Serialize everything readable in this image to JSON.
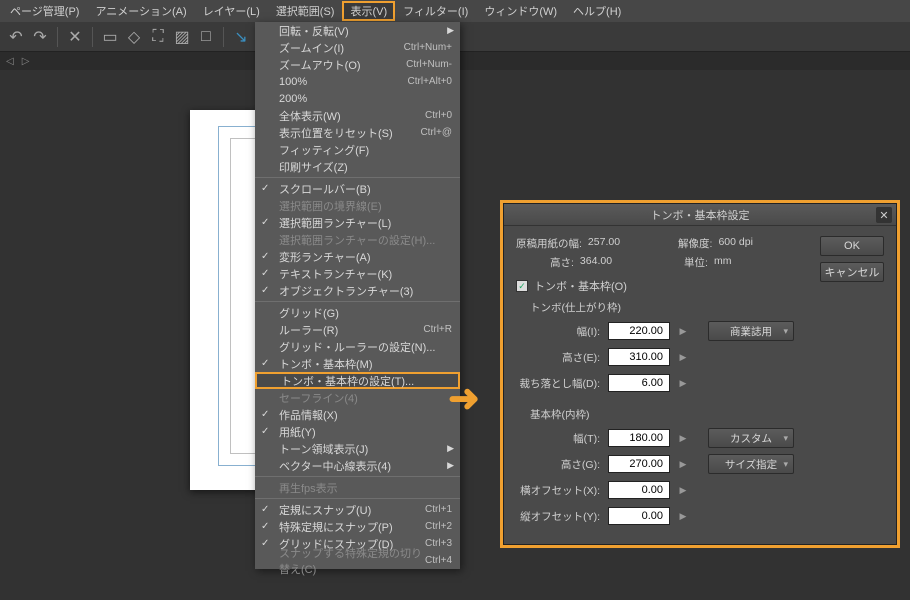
{
  "menubar": {
    "items": [
      "ページ管理(P)",
      "アニメーション(A)",
      "レイヤー(L)",
      "選択範囲(S)",
      "表示(V)",
      "フィルター(I)",
      "ウィンドウ(W)",
      "ヘルプ(H)"
    ],
    "highlighted_index": 4
  },
  "dropdown": {
    "title": "表示(V)",
    "groups": [
      [
        {
          "label": "回転・反転(V)",
          "arrow": true
        },
        {
          "label": "ズームイン(I)",
          "shortcut": "Ctrl+Num+"
        },
        {
          "label": "ズームアウト(O)",
          "shortcut": "Ctrl+Num-"
        },
        {
          "label": "100%",
          "shortcut": "Ctrl+Alt+0"
        },
        {
          "label": "200%"
        },
        {
          "label": "全体表示(W)",
          "shortcut": "Ctrl+0"
        },
        {
          "label": "表示位置をリセット(S)",
          "shortcut": "Ctrl+@"
        },
        {
          "label": "フィッティング(F)"
        },
        {
          "label": "印刷サイズ(Z)"
        }
      ],
      [
        {
          "label": "スクロールバー(B)",
          "checked": true
        },
        {
          "label": "選択範囲の境界線(E)",
          "disabled": true
        },
        {
          "label": "選択範囲ランチャー(L)",
          "checked": true
        },
        {
          "label": "選択範囲ランチャーの設定(H)...",
          "disabled": true
        },
        {
          "label": "変形ランチャー(A)",
          "checked": true
        },
        {
          "label": "テキストランチャー(K)",
          "checked": true
        },
        {
          "label": "オブジェクトランチャー(3)",
          "checked": true
        }
      ],
      [
        {
          "label": "グリッド(G)"
        },
        {
          "label": "ルーラー(R)",
          "shortcut": "Ctrl+R"
        },
        {
          "label": "グリッド・ルーラーの設定(N)..."
        },
        {
          "label": "トンボ・基本枠(M)",
          "checked": true
        },
        {
          "label": "トンボ・基本枠の設定(T)...",
          "highlight": true
        },
        {
          "label": "セーフライン(4)",
          "disabled": true
        },
        {
          "label": "作品情報(X)",
          "checked": true
        },
        {
          "label": "用紙(Y)",
          "checked": true
        },
        {
          "label": "トーン領域表示(J)",
          "arrow": true
        },
        {
          "label": "ベクター中心線表示(4)",
          "arrow": true
        }
      ],
      [
        {
          "label": "再生fps表示",
          "disabled": true
        }
      ],
      [
        {
          "label": "定規にスナップ(U)",
          "checked": true,
          "shortcut": "Ctrl+1"
        },
        {
          "label": "特殊定規にスナップ(P)",
          "checked": true,
          "shortcut": "Ctrl+2"
        },
        {
          "label": "グリッドにスナップ(D)",
          "checked": true,
          "shortcut": "Ctrl+3"
        },
        {
          "label": "スナップする特殊定規の切り替え(C)",
          "disabled": true,
          "shortcut": "Ctrl+4"
        }
      ]
    ]
  },
  "dialog": {
    "title": "トンボ・基本枠設定",
    "info": {
      "doc_width_label": "原稿用紙の幅:",
      "doc_width": "257.00",
      "resolution_label": "解像度:",
      "resolution": "600 dpi",
      "doc_height_label": "高さ:",
      "doc_height": "364.00",
      "unit_label": "単位:",
      "unit": "mm"
    },
    "checkbox_label": "トンボ・基本枠(O)",
    "trim_section": "トンボ(仕上がり枠)",
    "trim": {
      "width_label": "幅(I):",
      "width": "220.00",
      "height_label": "高さ(E):",
      "height": "310.00",
      "bleed_label": "裁ち落とし幅(D):",
      "bleed": "6.00",
      "preset": "商業誌用"
    },
    "frame_section": "基本枠(内枠)",
    "frame": {
      "width_label": "幅(T):",
      "width": "180.00",
      "height_label": "高さ(G):",
      "height": "270.00",
      "offx_label": "横オフセット(X):",
      "offx": "0.00",
      "offy_label": "縦オフセット(Y):",
      "offy": "0.00",
      "preset": "カスタム",
      "size_btn": "サイズ指定"
    },
    "ok": "OK",
    "cancel": "キャンセル"
  }
}
